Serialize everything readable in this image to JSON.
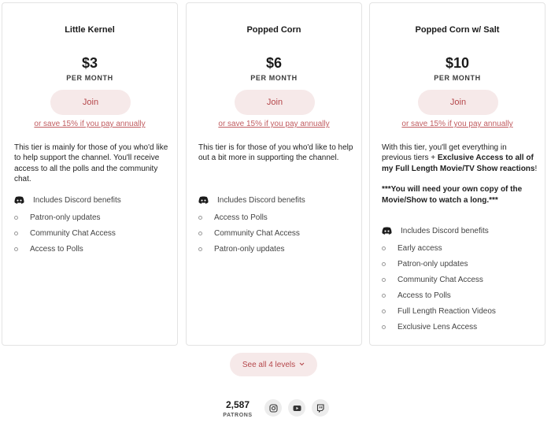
{
  "tiers": [
    {
      "name": "Little Kernel",
      "price": "$3",
      "period": "PER MONTH",
      "join_label": "Join",
      "save_label": "or save 15% if you pay annually",
      "description": "This tier is mainly for those of you who'd like to help support the channel. You'll receive access to all the polls and the community chat.",
      "discord_label": "Includes Discord benefits",
      "discord_icon": "discord-icon",
      "benefits": [
        "Patron-only updates",
        "Community Chat Access",
        "Access to Polls"
      ]
    },
    {
      "name": "Popped Corn",
      "price": "$6",
      "period": "PER MONTH",
      "join_label": "Join",
      "save_label": "or save 15% if you pay annually",
      "description": "This tier is for those of you who'd like to help out a bit more in supporting the channel.",
      "discord_label": "Includes Discord benefits",
      "discord_icon": "discord-icon",
      "benefits": [
        "Access to Polls",
        "Community Chat Access",
        "Patron-only updates"
      ]
    },
    {
      "name": "Popped Corn w/ Salt",
      "price": "$10",
      "period": "PER MONTH",
      "join_label": "Join",
      "save_label": "or save 15% if you pay annually",
      "description_parts": {
        "intro": "With this tier, you'll get everything in previous tiers + ",
        "bold": "Exclusive Access to all of my Full Length Movie/TV Show reactions",
        "end": "!",
        "note": "***You will need your own copy of the Movie/Show to watch a long.***"
      },
      "discord_label": "Includes Discord benefits",
      "discord_icon": "discord-icon",
      "benefits": [
        "Early access",
        "Patron-only updates",
        "Community Chat Access",
        "Access to Polls",
        "Full Length Reaction Videos",
        "Exclusive Lens Access"
      ]
    }
  ],
  "see_all_label": "See all 4 levels",
  "see_all_icon": "chevron-down-icon",
  "patrons": {
    "count": "2,587",
    "label": "PATRONS"
  },
  "social_icons": [
    "instagram-icon",
    "youtube-icon",
    "twitch-icon"
  ],
  "colors": {
    "accent": "#b5474b",
    "accent_bg": "#f6e9e9",
    "link": "#c15d61",
    "border": "#e3e3e3"
  }
}
